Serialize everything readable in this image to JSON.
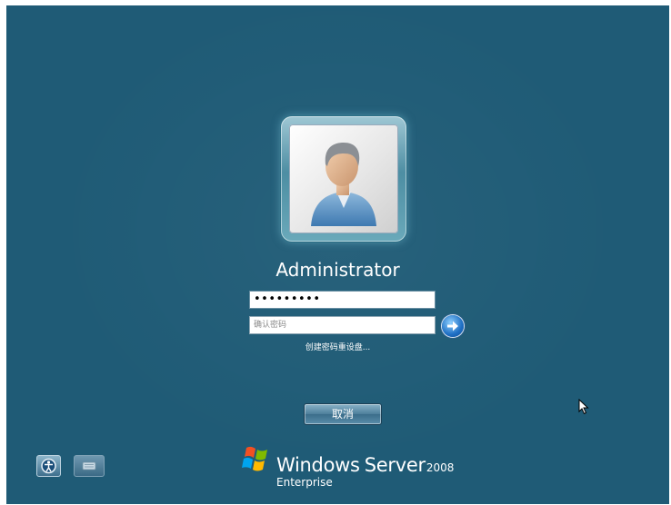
{
  "user": {
    "name": "Administrator",
    "avatar_icon": "user-silhouette-icon"
  },
  "password": {
    "value": "•••••••••"
  },
  "confirm_password": {
    "value": "",
    "placeholder": "确认密码"
  },
  "submit": {
    "icon": "arrow-right-icon"
  },
  "reset_disk_link": "创建密码重设盘...",
  "cancel_label": "取消",
  "bottom_left": {
    "ease_of_access_icon": "ease-of-access-icon",
    "keyboard_icon": "keyboard-icon"
  },
  "branding": {
    "windows": "Windows",
    "server": "Server",
    "version": "2008",
    "edition": "Enterprise",
    "logo_icon": "windows-flag-icon"
  },
  "colors": {
    "background": "#1f5b76",
    "accent": "#1f6fc4",
    "text": "#ffffff"
  }
}
